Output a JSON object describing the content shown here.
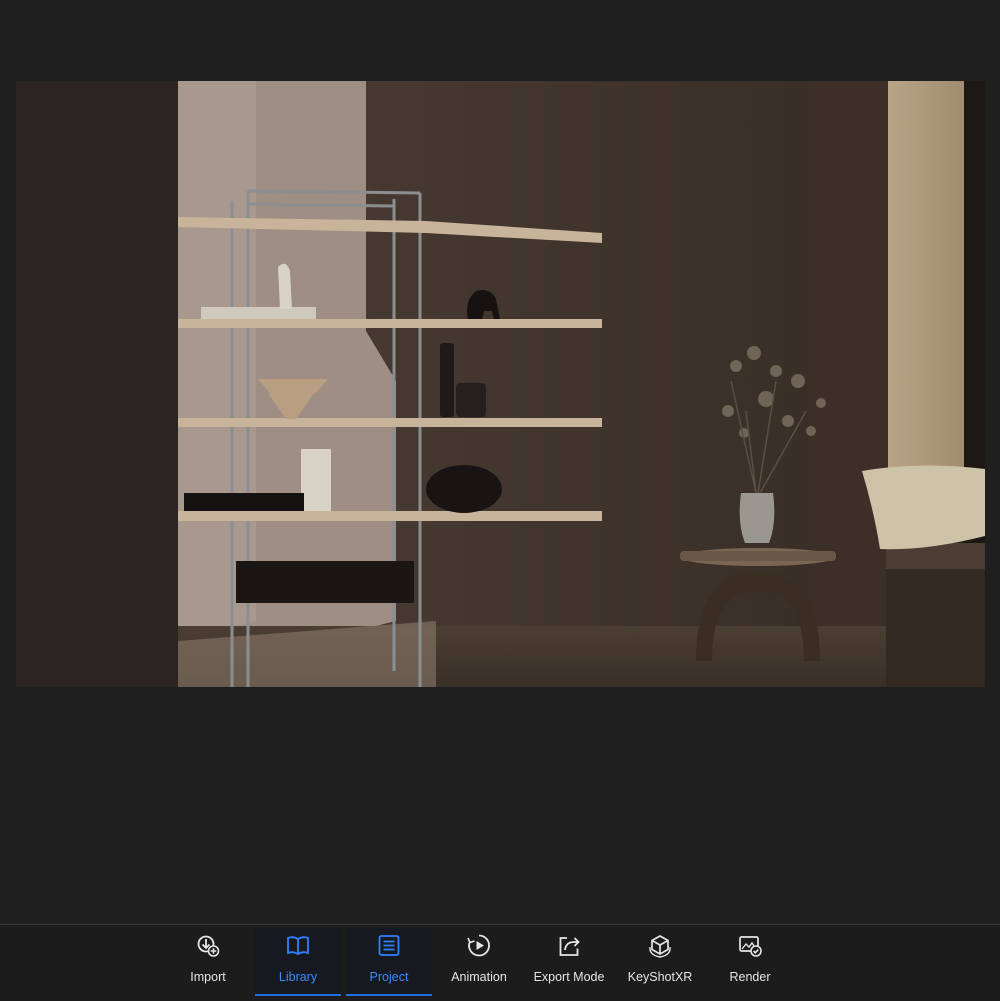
{
  "toolbar": {
    "accent_color": "#2f80ff",
    "items": [
      {
        "label": "Import",
        "icon": "import-icon"
      },
      {
        "label": "Library",
        "icon": "library-book-icon",
        "active": true
      },
      {
        "label": "Project",
        "icon": "project-list-icon",
        "active": true
      },
      {
        "label": "Animation",
        "icon": "animation-play-icon"
      },
      {
        "label": "Export Mode",
        "icon": "export-share-icon"
      },
      {
        "label": "KeyShotXR",
        "icon": "keyshotxr-cube-icon"
      },
      {
        "label": "Render",
        "icon": "render-icon"
      }
    ]
  }
}
